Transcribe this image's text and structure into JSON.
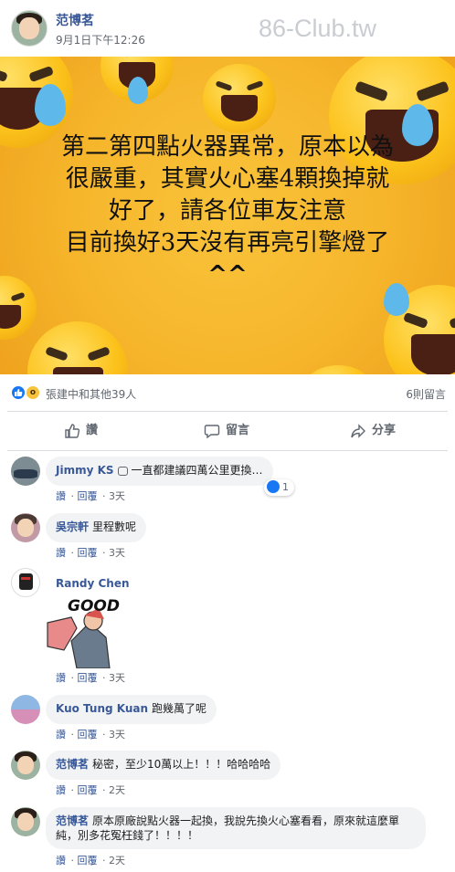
{
  "post": {
    "author": "范博茗",
    "timestamp": "9月1日下午12:26",
    "watermark": "86-Club.tw"
  },
  "banner": {
    "lines": [
      "第二第四點火器異常，原本以為",
      "很嚴重，其實火心塞4顆換掉就",
      "好了，請各位車友注意",
      "目前換好3天沒有再亮引擎燈了",
      "^^"
    ]
  },
  "reactions": {
    "summary": "張建中和其他39人",
    "comments_count": "6則留言",
    "icons": [
      "like-icon",
      "wow-icon"
    ]
  },
  "actions": {
    "like": "讚",
    "comment": "留言",
    "share": "分享"
  },
  "comments": [
    {
      "name": "Jimmy KS",
      "text": "一直都建議四萬公里更換…",
      "like": "讚",
      "reply": "回覆",
      "age": "3天",
      "reaction_count": "1"
    },
    {
      "name": "吳宗軒",
      "text": "里程數呢",
      "like": "讚",
      "reply": "回覆",
      "age": "3天"
    },
    {
      "name": "Randy Chen",
      "text": "",
      "sticker_text": "GOOD",
      "like": "讚",
      "reply": "回覆",
      "age": "3天"
    },
    {
      "name": "Kuo Tung Kuan",
      "text": "跑幾萬了呢",
      "like": "讚",
      "reply": "回覆",
      "age": "3天"
    },
    {
      "name": "范博茗",
      "text": "秘密，至少10萬以上！！！哈哈哈哈",
      "like": "讚",
      "reply": "回覆",
      "age": "2天"
    },
    {
      "name": "范博茗",
      "text": "原本原廠說點火器一起換，我說先換火心塞看看，原來就這麼單純，別多花冤枉錢了！！！！",
      "like": "讚",
      "reply": "回覆",
      "age": "2天"
    }
  ],
  "colors": {
    "link": "#385898",
    "banner_bg": "#f6b62c",
    "like_blue": "#1877f2",
    "bubble_bg": "#f2f3f5"
  }
}
